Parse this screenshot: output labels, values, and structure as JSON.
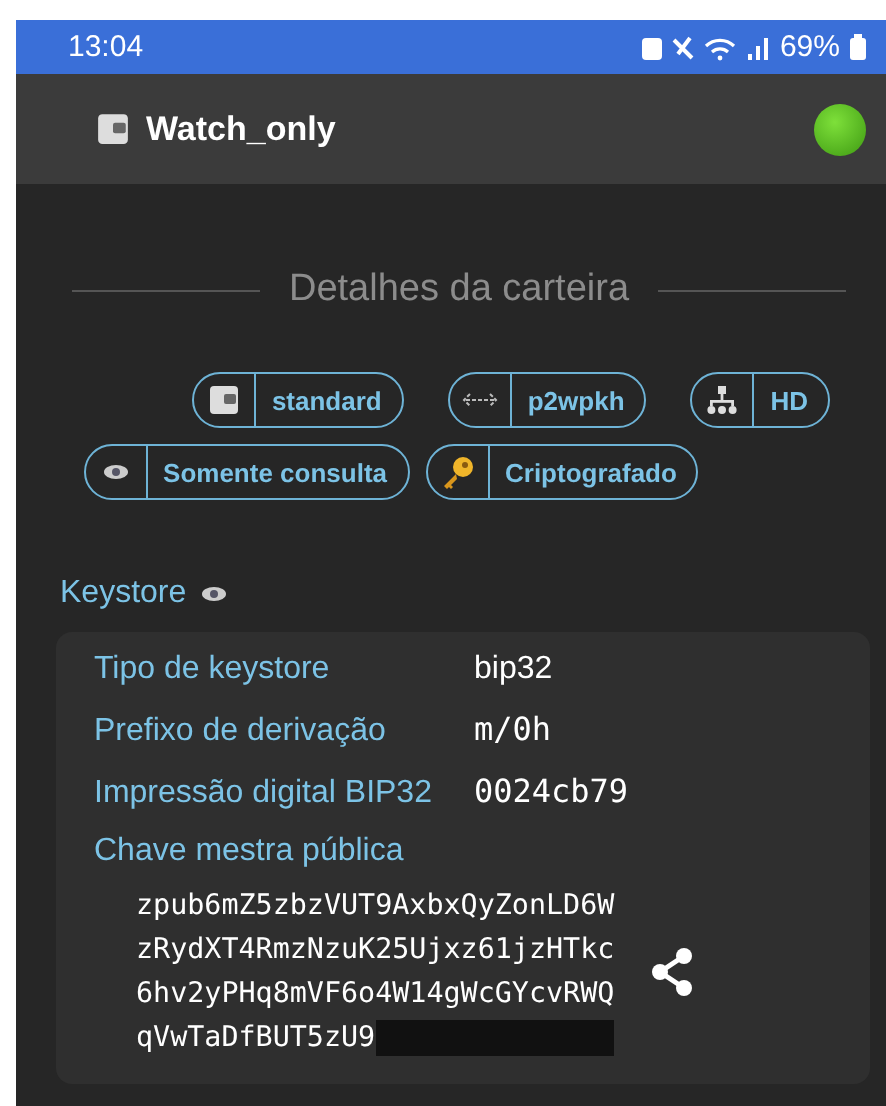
{
  "status_bar": {
    "time": "13:04",
    "battery": "69%"
  },
  "app_bar": {
    "title": "Watch_only"
  },
  "section_title": "Detalhes da carteira",
  "tag_rows": [
    [
      {
        "label": "standard",
        "kind": "wallet"
      },
      {
        "label": "p2wpkh",
        "kind": "arrows"
      },
      {
        "label": "HD",
        "kind": "tree"
      }
    ],
    [
      {
        "label": "Somente consulta",
        "kind": "eye"
      },
      {
        "label": "Criptografado",
        "kind": "key"
      }
    ]
  ],
  "keystore": {
    "title": "Keystore",
    "rows": [
      {
        "label": "Tipo de keystore",
        "value": "bip32",
        "kind": "sans"
      },
      {
        "label": "Prefixo de derivação",
        "value": "m/0h",
        "kind": "mono"
      },
      {
        "label": "Impressão digital BIP32",
        "value": "0024cb79",
        "kind": "mono"
      }
    ],
    "master_key": {
      "label": "Chave mestra pública",
      "lines": [
        "zpub6mZ5zbzVUT9AxbxQyZonLD6W",
        "zRydXT4RmzNzuK25Ujxz61jzHTkc",
        "6hv2yPHq8mVF6o4W14gWcGYcvRWQ",
        "qVwTaDfBUT5zU9"
      ],
      "redacted": true
    }
  }
}
